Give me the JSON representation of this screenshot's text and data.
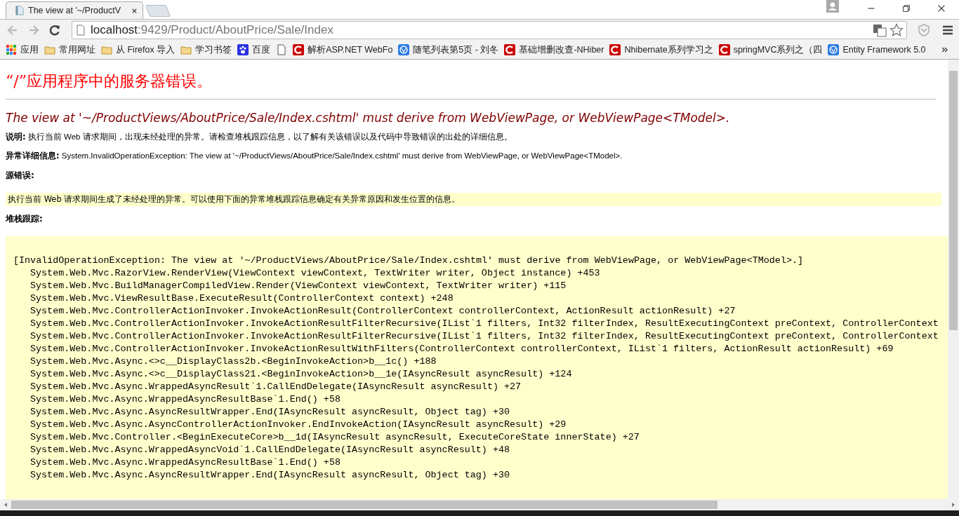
{
  "browser": {
    "tabs": [
      {
        "title": "The view at '~/ProductV",
        "selected": true
      }
    ],
    "address": {
      "host": "localhost",
      "path": ":9429/Product/AboutPrice/Sale/Index"
    },
    "bookmarks": [
      {
        "kind": "apps",
        "label": "应用"
      },
      {
        "kind": "folder",
        "label": "常用网址"
      },
      {
        "kind": "folder",
        "label": "从 Firefox 导入"
      },
      {
        "kind": "folder",
        "label": "学习书签"
      },
      {
        "kind": "paw",
        "label": "百度"
      },
      {
        "kind": "page"
      },
      {
        "kind": "red",
        "label": "解析ASP.NET WebFo"
      },
      {
        "kind": "blue",
        "label": "随笔列表第5页 - 刘冬"
      },
      {
        "kind": "red",
        "label": "基础增删改查-NHiber"
      },
      {
        "kind": "red",
        "label": "Nhibernate系列学习之"
      },
      {
        "kind": "red",
        "label": "springMVC系列之（四"
      },
      {
        "kind": "blue",
        "label": "Entity Framework 5.0"
      }
    ]
  },
  "page": {
    "title": "“/”应用程序中的服务器错误。",
    "message": "The view at '~/ProductViews/AboutPrice/Sale/Index.cshtml' must derive from WebViewPage, or WebViewPage<TModel>.",
    "fields": [
      {
        "label": "说明:",
        "text": "执行当前 Web 请求期间，出现未经处理的异常。请检查堆栈跟踪信息，以了解有关该错误以及代码中导致错误的出处的详细信息。"
      },
      {
        "label": "异常详细信息:",
        "text": "System.InvalidOperationException: The view at '~/ProductViews/AboutPrice/Sale/Index.cshtml' must derive from WebViewPage, or WebViewPage<TModel>."
      }
    ],
    "source_label": "源错误:",
    "source_text": "执行当前 Web 请求期间生成了未经处理的异常。可以使用下面的异常堆栈跟踪信息确定有关异常原因和发生位置的信息。",
    "stack_label": "堆栈跟踪:",
    "stack_lines": [
      {
        "kind": "header",
        "text": "[InvalidOperationException: The view at '~/ProductViews/AboutPrice/Sale/Index.cshtml' must derive from WebViewPage, or WebViewPage<TModel>.]"
      },
      {
        "kind": "frame",
        "text": "System.Web.Mvc.RazorView.RenderView(ViewContext viewContext, TextWriter writer, Object instance) +453"
      },
      {
        "kind": "frame",
        "text": "System.Web.Mvc.BuildManagerCompiledView.Render(ViewContext viewContext, TextWriter writer) +115"
      },
      {
        "kind": "frame",
        "text": "System.Web.Mvc.ViewResultBase.ExecuteResult(ControllerContext context) +248"
      },
      {
        "kind": "frame",
        "text": "System.Web.Mvc.ControllerActionInvoker.InvokeActionResult(ControllerContext controllerContext, ActionResult actionResult) +27"
      },
      {
        "kind": "frame",
        "text": "System.Web.Mvc.ControllerActionInvoker.InvokeActionResultFilterRecursive(IList`1 filters, Int32 filterIndex, ResultExecutingContext preContext, ControllerContext"
      },
      {
        "kind": "frame",
        "text": "System.Web.Mvc.ControllerActionInvoker.InvokeActionResultFilterRecursive(IList`1 filters, Int32 filterIndex, ResultExecutingContext preContext, ControllerContext"
      },
      {
        "kind": "frame",
        "text": "System.Web.Mvc.ControllerActionInvoker.InvokeActionResultWithFilters(ControllerContext controllerContext, IList`1 filters, ActionResult actionResult) +69"
      },
      {
        "kind": "frame",
        "text": "System.Web.Mvc.Async.<>c__DisplayClass2b.<BeginInvokeAction>b__1c() +188"
      },
      {
        "kind": "frame",
        "text": "System.Web.Mvc.Async.<>c__DisplayClass21.<BeginInvokeAction>b__1e(IAsyncResult asyncResult) +124"
      },
      {
        "kind": "frame",
        "text": "System.Web.Mvc.Async.WrappedAsyncResult`1.CallEndDelegate(IAsyncResult asyncResult) +27"
      },
      {
        "kind": "frame",
        "text": "System.Web.Mvc.Async.WrappedAsyncResultBase`1.End() +58"
      },
      {
        "kind": "frame",
        "text": "System.Web.Mvc.Async.AsyncResultWrapper.End(IAsyncResult asyncResult, Object tag) +30"
      },
      {
        "kind": "frame",
        "text": "System.Web.Mvc.Async.AsyncControllerActionInvoker.EndInvokeAction(IAsyncResult asyncResult) +29"
      },
      {
        "kind": "frame",
        "text": "System.Web.Mvc.Controller.<BeginExecuteCore>b__1d(IAsyncResult asyncResult, ExecuteCoreState innerState) +27"
      },
      {
        "kind": "frame",
        "text": "System.Web.Mvc.Async.WrappedAsyncVoid`1.CallEndDelegate(IAsyncResult asyncResult) +48"
      },
      {
        "kind": "frame",
        "text": "System.Web.Mvc.Async.WrappedAsyncResultBase`1.End() +58"
      },
      {
        "kind": "frame",
        "text": "System.Web.Mvc.Async.AsyncResultWrapper.End(IAsyncResult asyncResult, Object tag) +30"
      }
    ]
  }
}
